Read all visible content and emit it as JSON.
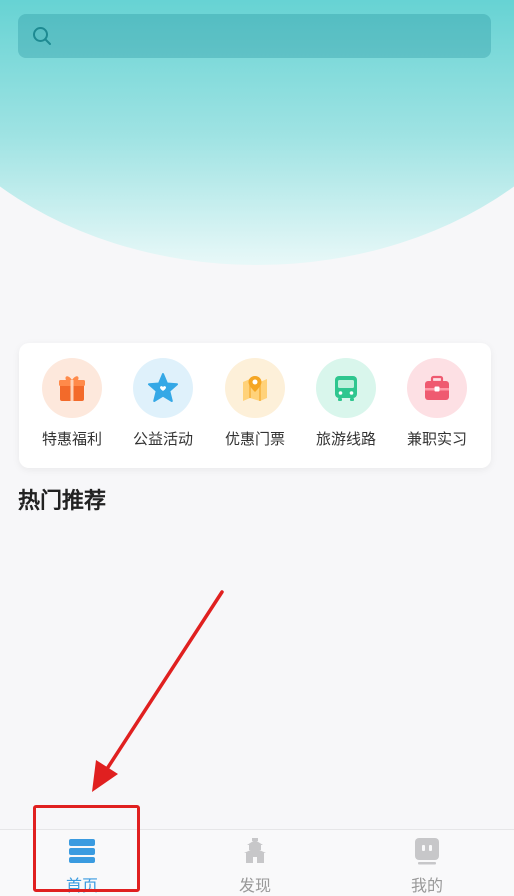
{
  "search": {
    "icon": "search-icon",
    "placeholder": ""
  },
  "categories": [
    {
      "label": "特惠福利",
      "icon": "gift-icon",
      "bg": "#fde8dc",
      "color": "#f36a2a"
    },
    {
      "label": "公益活动",
      "icon": "star-icon",
      "bg": "#dff1fb",
      "color": "#35a8e6"
    },
    {
      "label": "优惠门票",
      "icon": "map-pin-icon",
      "bg": "#fdf0d9",
      "color": "#f5b13c"
    },
    {
      "label": "旅游线路",
      "icon": "bus-icon",
      "bg": "#d9f6ec",
      "color": "#2fc68f"
    },
    {
      "label": "兼职实习",
      "icon": "briefcase-icon",
      "bg": "#fde0e4",
      "color": "#ef5a70"
    }
  ],
  "section": {
    "title": "热门推荐"
  },
  "tabbar": [
    {
      "label": "首页",
      "icon": "home-stack-icon",
      "active": true
    },
    {
      "label": "发现",
      "icon": "pagoda-icon",
      "active": false
    },
    {
      "label": "我的",
      "icon": "profile-icon",
      "active": false
    }
  ],
  "colors": {
    "accent": "#3a9be0",
    "annotation": "#e02020",
    "hero_top": "#35c2c4"
  }
}
